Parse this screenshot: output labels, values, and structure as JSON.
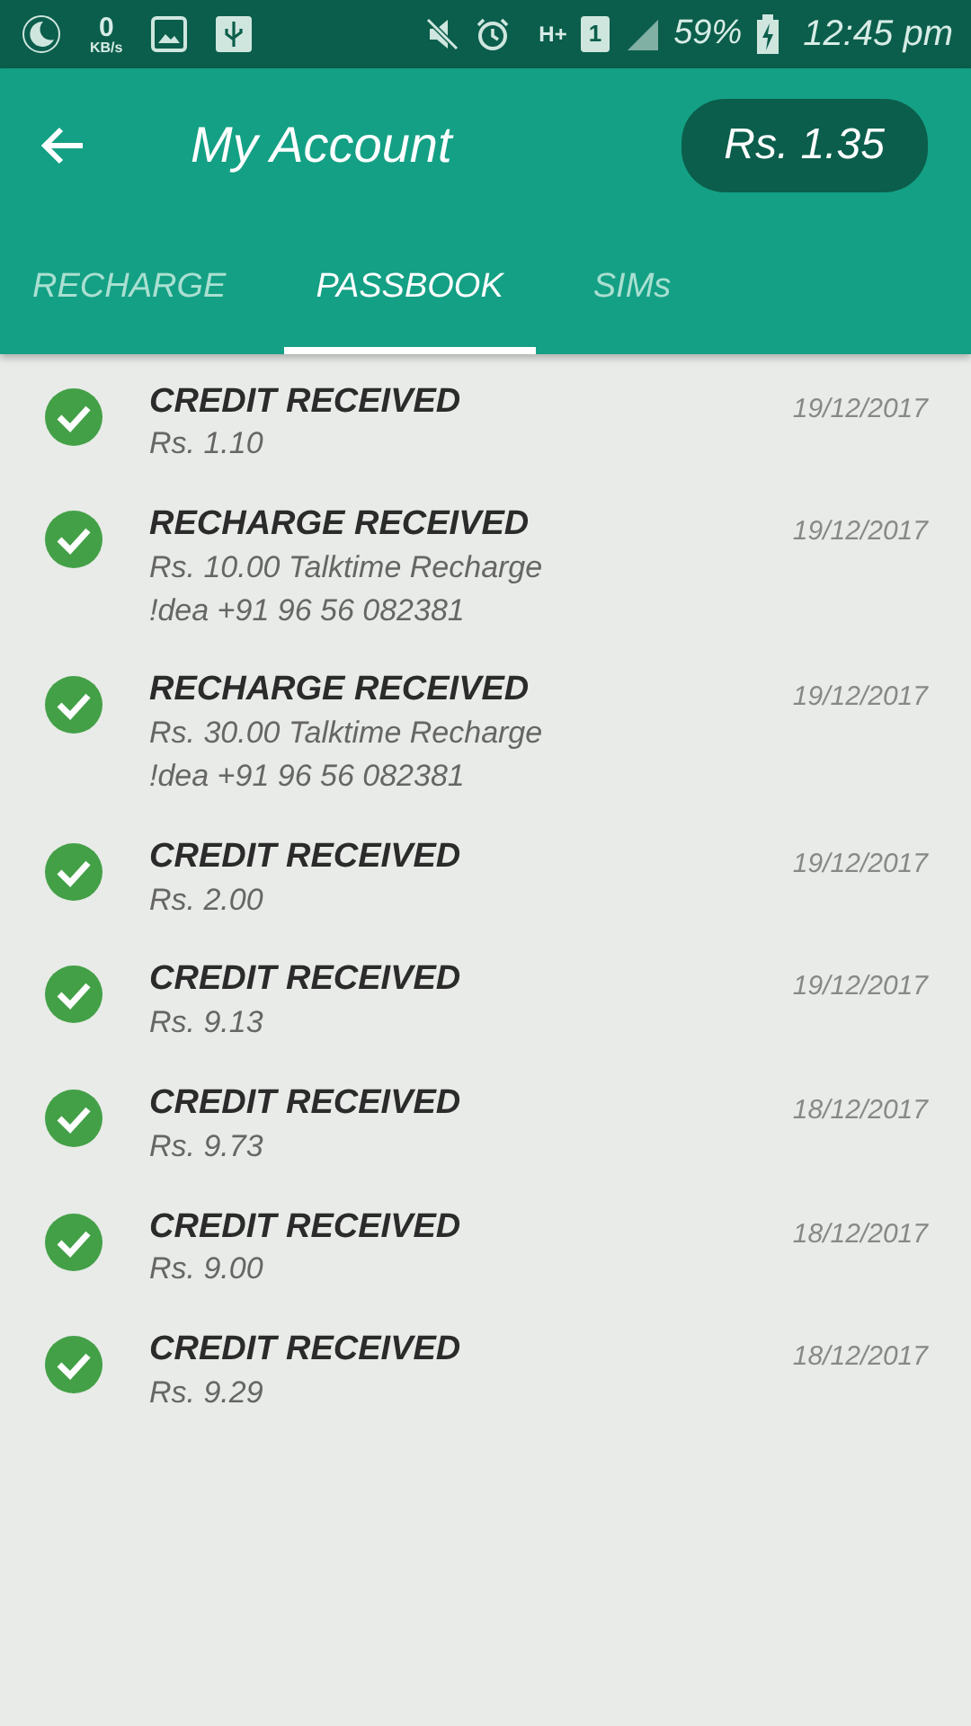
{
  "status_bar": {
    "speed": "0",
    "speed_unit": "KB/s",
    "network": "H+",
    "sim": "1",
    "battery": "59%",
    "time": "12:45 pm"
  },
  "header": {
    "title": "My Account",
    "balance": "Rs. 1.35"
  },
  "tabs": [
    {
      "label": "RECHARGE",
      "selected": false
    },
    {
      "label": "PASSBOOK",
      "selected": true
    },
    {
      "label": "SIMs",
      "selected": false
    }
  ],
  "transactions": [
    {
      "title": "CREDIT RECEIVED",
      "date": "19/12/2017",
      "lines": [
        "Rs. 1.10"
      ]
    },
    {
      "title": "RECHARGE RECEIVED",
      "date": "19/12/2017",
      "lines": [
        "Rs. 10.00 Talktime Recharge",
        "!dea  +91 96 56 082381"
      ]
    },
    {
      "title": "RECHARGE RECEIVED",
      "date": "19/12/2017",
      "lines": [
        "Rs. 30.00 Talktime Recharge",
        "!dea  +91 96 56 082381"
      ]
    },
    {
      "title": "CREDIT RECEIVED",
      "date": "19/12/2017",
      "lines": [
        "Rs. 2.00"
      ]
    },
    {
      "title": "CREDIT RECEIVED",
      "date": "19/12/2017",
      "lines": [
        "Rs. 9.13"
      ]
    },
    {
      "title": "CREDIT RECEIVED",
      "date": "18/12/2017",
      "lines": [
        "Rs. 9.73"
      ]
    },
    {
      "title": "CREDIT RECEIVED",
      "date": "18/12/2017",
      "lines": [
        "Rs. 9.00"
      ]
    },
    {
      "title": "CREDIT RECEIVED",
      "date": "18/12/2017",
      "lines": [
        "Rs. 9.29"
      ]
    }
  ]
}
